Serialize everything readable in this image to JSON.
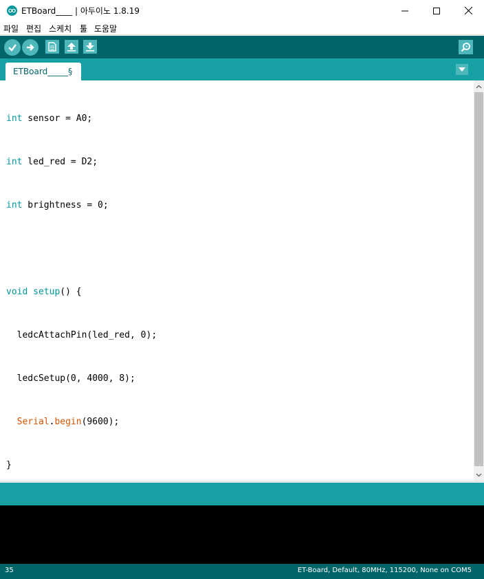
{
  "window": {
    "title": "ETBoard____ | 아두이노 1.8.19"
  },
  "menu": {
    "items": [
      "파일",
      "편집",
      "스케치",
      "툴",
      "도움말"
    ]
  },
  "toolbar": {
    "buttons": [
      "verify-icon",
      "upload-icon",
      "new-icon",
      "open-icon",
      "save-icon",
      "serial-monitor-icon"
    ]
  },
  "tabs": [
    {
      "label": "ETBoard_____§"
    }
  ],
  "editor": {
    "lines": [
      "int sensor = A0;",
      "int led_red = D2;",
      "int brightness = 0;",
      "",
      "void setup() {",
      "  ledcAttachPin(led_red, 0);",
      "  ledcSetup(0, 4000, 8);",
      "  Serial.begin(9600);",
      "}"
    ]
  },
  "status": {
    "line": "35",
    "board": "ET-Board, Default, 80MHz, 115200, None on COM5"
  },
  "colors": {
    "toolbar": "#006468",
    "tabbar": "#17a1a5",
    "button": "#4db7bb",
    "keyword": "#00979c",
    "function": "#d35400",
    "console": "#000000"
  }
}
